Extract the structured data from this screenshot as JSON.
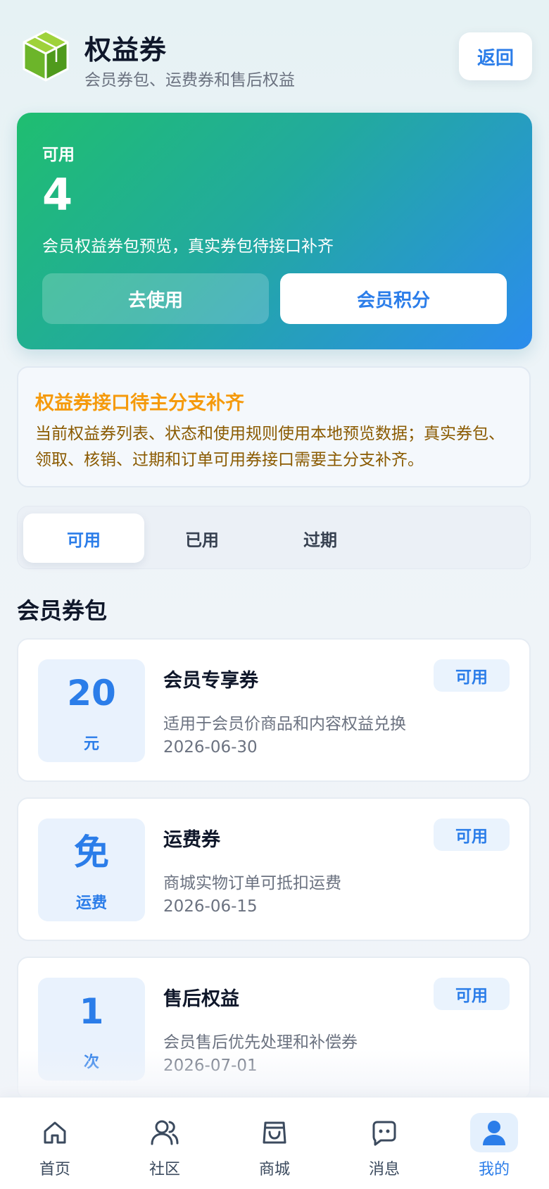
{
  "header": {
    "title": "权益券",
    "subtitle": "会员券包、运费券和售后权益",
    "back_label": "返回"
  },
  "hero": {
    "label": "可用",
    "count": "4",
    "description": "会员权益券包预览，真实券包待接口补齐",
    "use_button": "去使用",
    "points_button": "会员积分"
  },
  "notice": {
    "title": "权益券接口待主分支补齐",
    "body": "当前权益券列表、状态和使用规则使用本地预览数据；真实券包、领取、核销、过期和订单可用券接口需要主分支补齐。"
  },
  "tabs": [
    {
      "label": "可用",
      "active": true
    },
    {
      "label": "已用",
      "active": false
    },
    {
      "label": "过期",
      "active": false
    }
  ],
  "section_title": "会员券包",
  "coupons": [
    {
      "value": "20",
      "unit": "元",
      "name": "会员专享券",
      "status": "可用",
      "description": "适用于会员价商品和内容权益兑换",
      "expiry": "2026-06-30"
    },
    {
      "value": "免",
      "unit": "运费",
      "name": "运费券",
      "status": "可用",
      "description": "商城实物订单可抵扣运费",
      "expiry": "2026-06-15"
    },
    {
      "value": "1",
      "unit": "次",
      "name": "售后权益",
      "status": "可用",
      "description": "会员售后优先处理和补偿券",
      "expiry": "2026-07-01"
    }
  ],
  "nav": [
    {
      "label": "首页",
      "icon": "home-icon",
      "active": false
    },
    {
      "label": "社区",
      "icon": "community-icon",
      "active": false
    },
    {
      "label": "商城",
      "icon": "shop-icon",
      "active": false
    },
    {
      "label": "消息",
      "icon": "message-icon",
      "active": false
    },
    {
      "label": "我的",
      "icon": "profile-icon",
      "active": true
    }
  ],
  "colors": {
    "accent": "#2b7de9",
    "warning": "#f59a0c",
    "hero_start": "#1fbe70",
    "hero_end": "#2b8ced"
  }
}
